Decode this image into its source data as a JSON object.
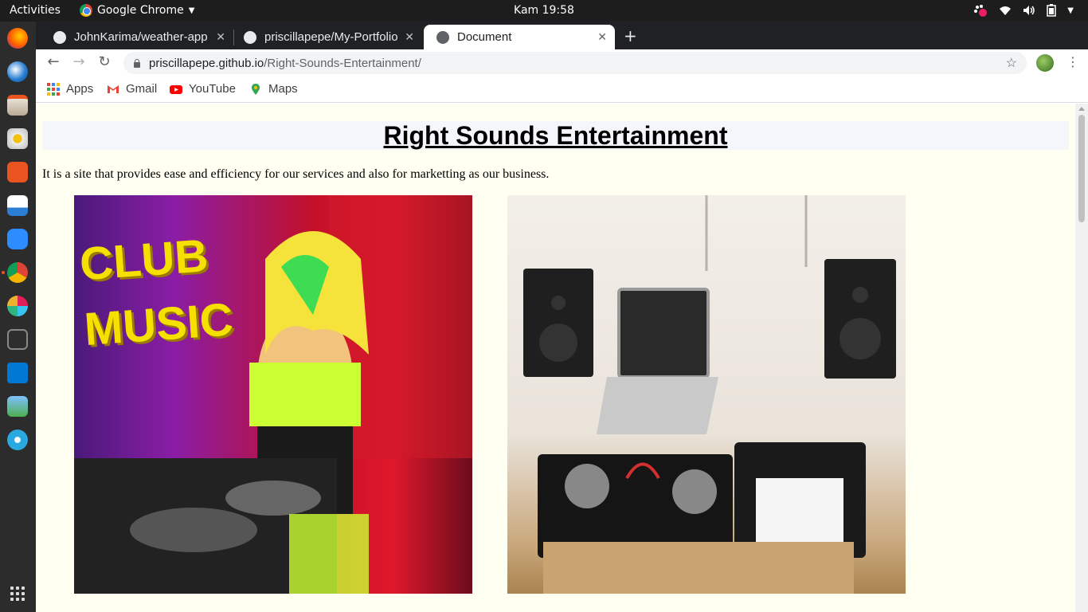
{
  "system": {
    "activities_label": "Activities",
    "app_menu_label": "Google Chrome",
    "clock": "Kam 19:58"
  },
  "dock": {
    "items": [
      "firefox-icon",
      "thunderbird-icon",
      "files-icon",
      "rhythmbox-icon",
      "software-center-icon",
      "libreoffice-writer-icon",
      "zoom-icon",
      "chrome-icon",
      "slack-icon",
      "terminal-icon",
      "vscode-icon",
      "image-viewer-icon",
      "settings-icon",
      "show-applications-icon"
    ]
  },
  "browser": {
    "tabs": [
      {
        "title": "JohnKarima/weather-app",
        "favicon": "github-icon",
        "active": false
      },
      {
        "title": "priscillapepe/My-Portfolio",
        "favicon": "github-icon",
        "active": false
      },
      {
        "title": "Document",
        "favicon": "globe-icon",
        "active": true
      }
    ],
    "url_host": "priscillapepe.github.io",
    "url_path": "/Right-Sounds-Entertainment/",
    "bookmarks": [
      {
        "label": "Apps",
        "icon": "apps-grid-icon"
      },
      {
        "label": "Gmail",
        "icon": "gmail-icon"
      },
      {
        "label": "YouTube",
        "icon": "youtube-icon"
      },
      {
        "label": "Maps",
        "icon": "maps-pin-icon"
      }
    ]
  },
  "page": {
    "title": "Right Sounds Entertainment",
    "intro": "It is a site that provides ease and efficiency for our services and also for marketting as our business.",
    "images": [
      {
        "name": "club-music-photo",
        "text": "CLUB MUSIC"
      },
      {
        "name": "dj-setup-photo",
        "text": ""
      }
    ]
  },
  "colors": {
    "page_background": "#fffff2",
    "heading_band": "#f4f6fb",
    "ubuntu_accent": "#e95420"
  }
}
